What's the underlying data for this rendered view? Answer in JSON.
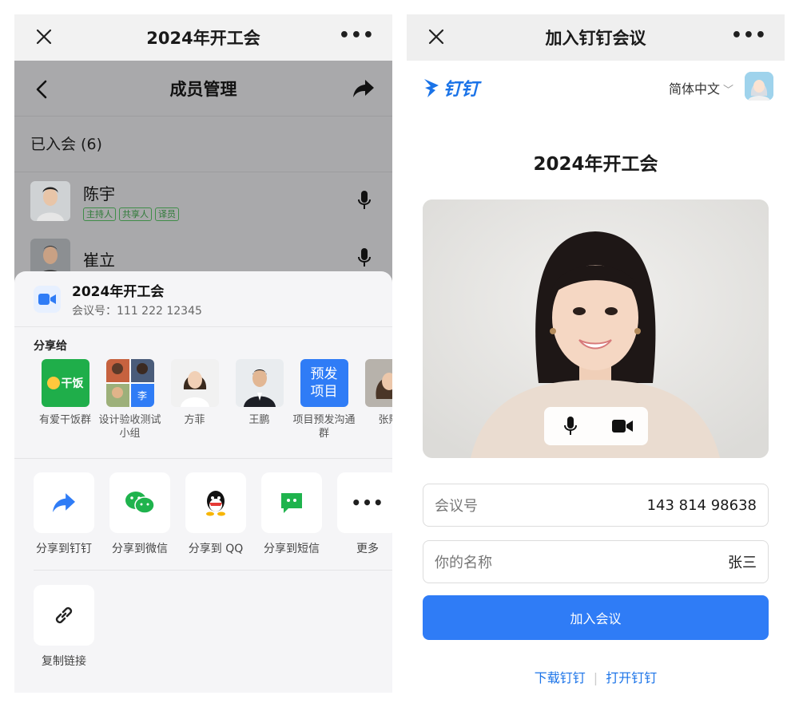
{
  "left": {
    "title": "2024年开工会",
    "member_page": {
      "title": "成员管理",
      "joined_label": "已入会 (6)",
      "members": [
        {
          "name": "陈宇",
          "tags": [
            "主持人",
            "共享人",
            "译员"
          ]
        },
        {
          "name": "崔立",
          "tags": []
        }
      ]
    },
    "sheet": {
      "meeting_name": "2024年开工会",
      "meeting_id": "会议号：111 222 12345",
      "share_to": "分享给",
      "contacts": [
        {
          "label": "有爱干饭群",
          "badge": "干饭"
        },
        {
          "label": "设计验收测试小组",
          "badge": "李"
        },
        {
          "label": "方菲"
        },
        {
          "label": "王鹏"
        },
        {
          "label": "项目预发沟通群",
          "badge": "预发项目"
        },
        {
          "label": "张熙"
        }
      ],
      "actions": [
        {
          "label": "分享到钉钉",
          "icon": "share-arrow-icon"
        },
        {
          "label": "分享到微信",
          "icon": "wechat-icon"
        },
        {
          "label": "分享到 QQ",
          "icon": "qq-icon"
        },
        {
          "label": "分享到短信",
          "icon": "sms-icon"
        },
        {
          "label": "更多",
          "icon": "more-icon"
        }
      ],
      "copy_link": "复制链接"
    }
  },
  "right": {
    "title": "加入钉钉会议",
    "brand": "钉钉",
    "language": "简体中文",
    "meeting_title": "2024年开工会",
    "meeting_id_label": "会议号",
    "meeting_id_value": "143 814 98638",
    "name_label": "你的名称",
    "name_value": "张三",
    "join_button": "加入会议",
    "download_link": "下载钉钉",
    "open_link": "打开钉钉",
    "colors": {
      "accent": "#2f7cf6",
      "brand": "#1a73e8"
    }
  }
}
